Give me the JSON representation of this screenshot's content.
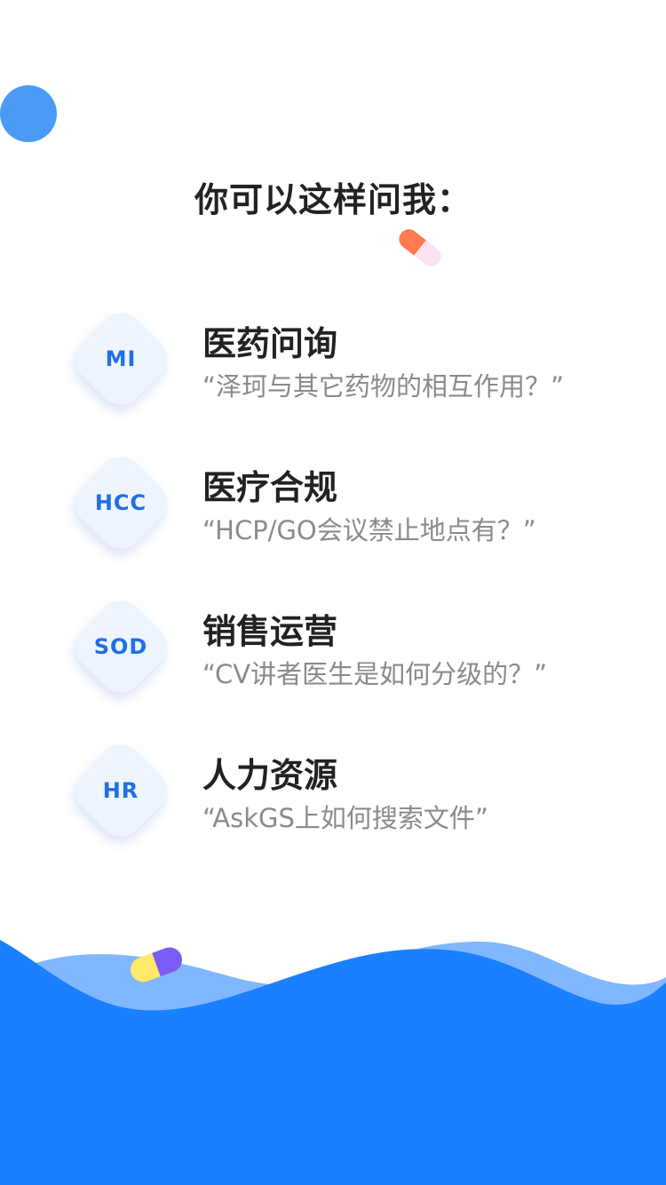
{
  "heading": "你可以这样问我：",
  "topics": [
    {
      "badge": "MI",
      "title": "医药问询",
      "example": "“泽珂与其它药物的相互作用？”"
    },
    {
      "badge": "HCC",
      "title": "医疗合规",
      "example": "“HCP/GO会议禁止地点有？”"
    },
    {
      "badge": "SOD",
      "title": "销售运营",
      "example": "“CV讲者医生是如何分级的？”"
    },
    {
      "badge": "HR",
      "title": "人力资源",
      "example": "“AskGS上如何搜索文件”"
    }
  ],
  "colors": {
    "brand_blue": "#1a80ff",
    "light_blue": "#80b7ff",
    "badge_text": "#1f6fe6",
    "pill_orange": "#ff7a50",
    "pill_yellow": "#ffe96b",
    "pill_purple": "#7b5cf5"
  }
}
